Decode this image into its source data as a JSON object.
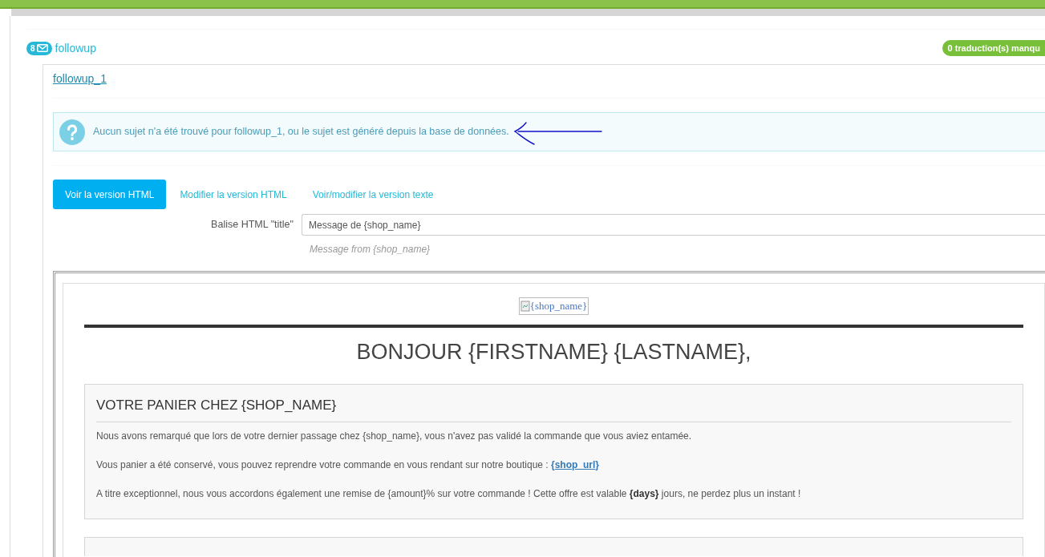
{
  "module": {
    "count": "8",
    "name": "followup",
    "missing_badge": "0 traduction(s) manqu"
  },
  "template": {
    "name": "followup_1"
  },
  "alert": {
    "text": "Aucun sujet n'a été trouvé pour followup_1, ou le sujet est généré depuis la base de données."
  },
  "tabs": [
    {
      "label": "Voir la version HTML",
      "selected": true
    },
    {
      "label": "Modifier la version HTML",
      "selected": false
    },
    {
      "label": "Voir/modifier la version texte",
      "selected": false
    }
  ],
  "title_field": {
    "label": "Balise HTML \"title\"",
    "value": "Message de {shop_name}",
    "hint": "Message from {shop_name}"
  },
  "preview": {
    "logo_alt": "{shop_name}",
    "greeting": "BONJOUR {FIRSTNAME} {LASTNAME},",
    "panel": {
      "heading": "VOTRE PANIER CHEZ {SHOP_NAME}",
      "paragraphs": [
        {
          "text": "Nous avons remarqué que lors de votre dernier passage chez {shop_name}, vous n'avez pas validé la commande que vous aviez entamée."
        },
        {
          "text": "Vous panier a été conservé, vous pouvez reprendre votre commande en vous rendant sur notre boutique : ",
          "link": "{shop_url}"
        },
        {
          "text": "A titre exceptionnel, nous vous accordons également une remise de {amount}% sur votre commande ! Cette offre est valable **{days}** jours, ne perdez plus un instant !"
        }
      ]
    }
  }
}
